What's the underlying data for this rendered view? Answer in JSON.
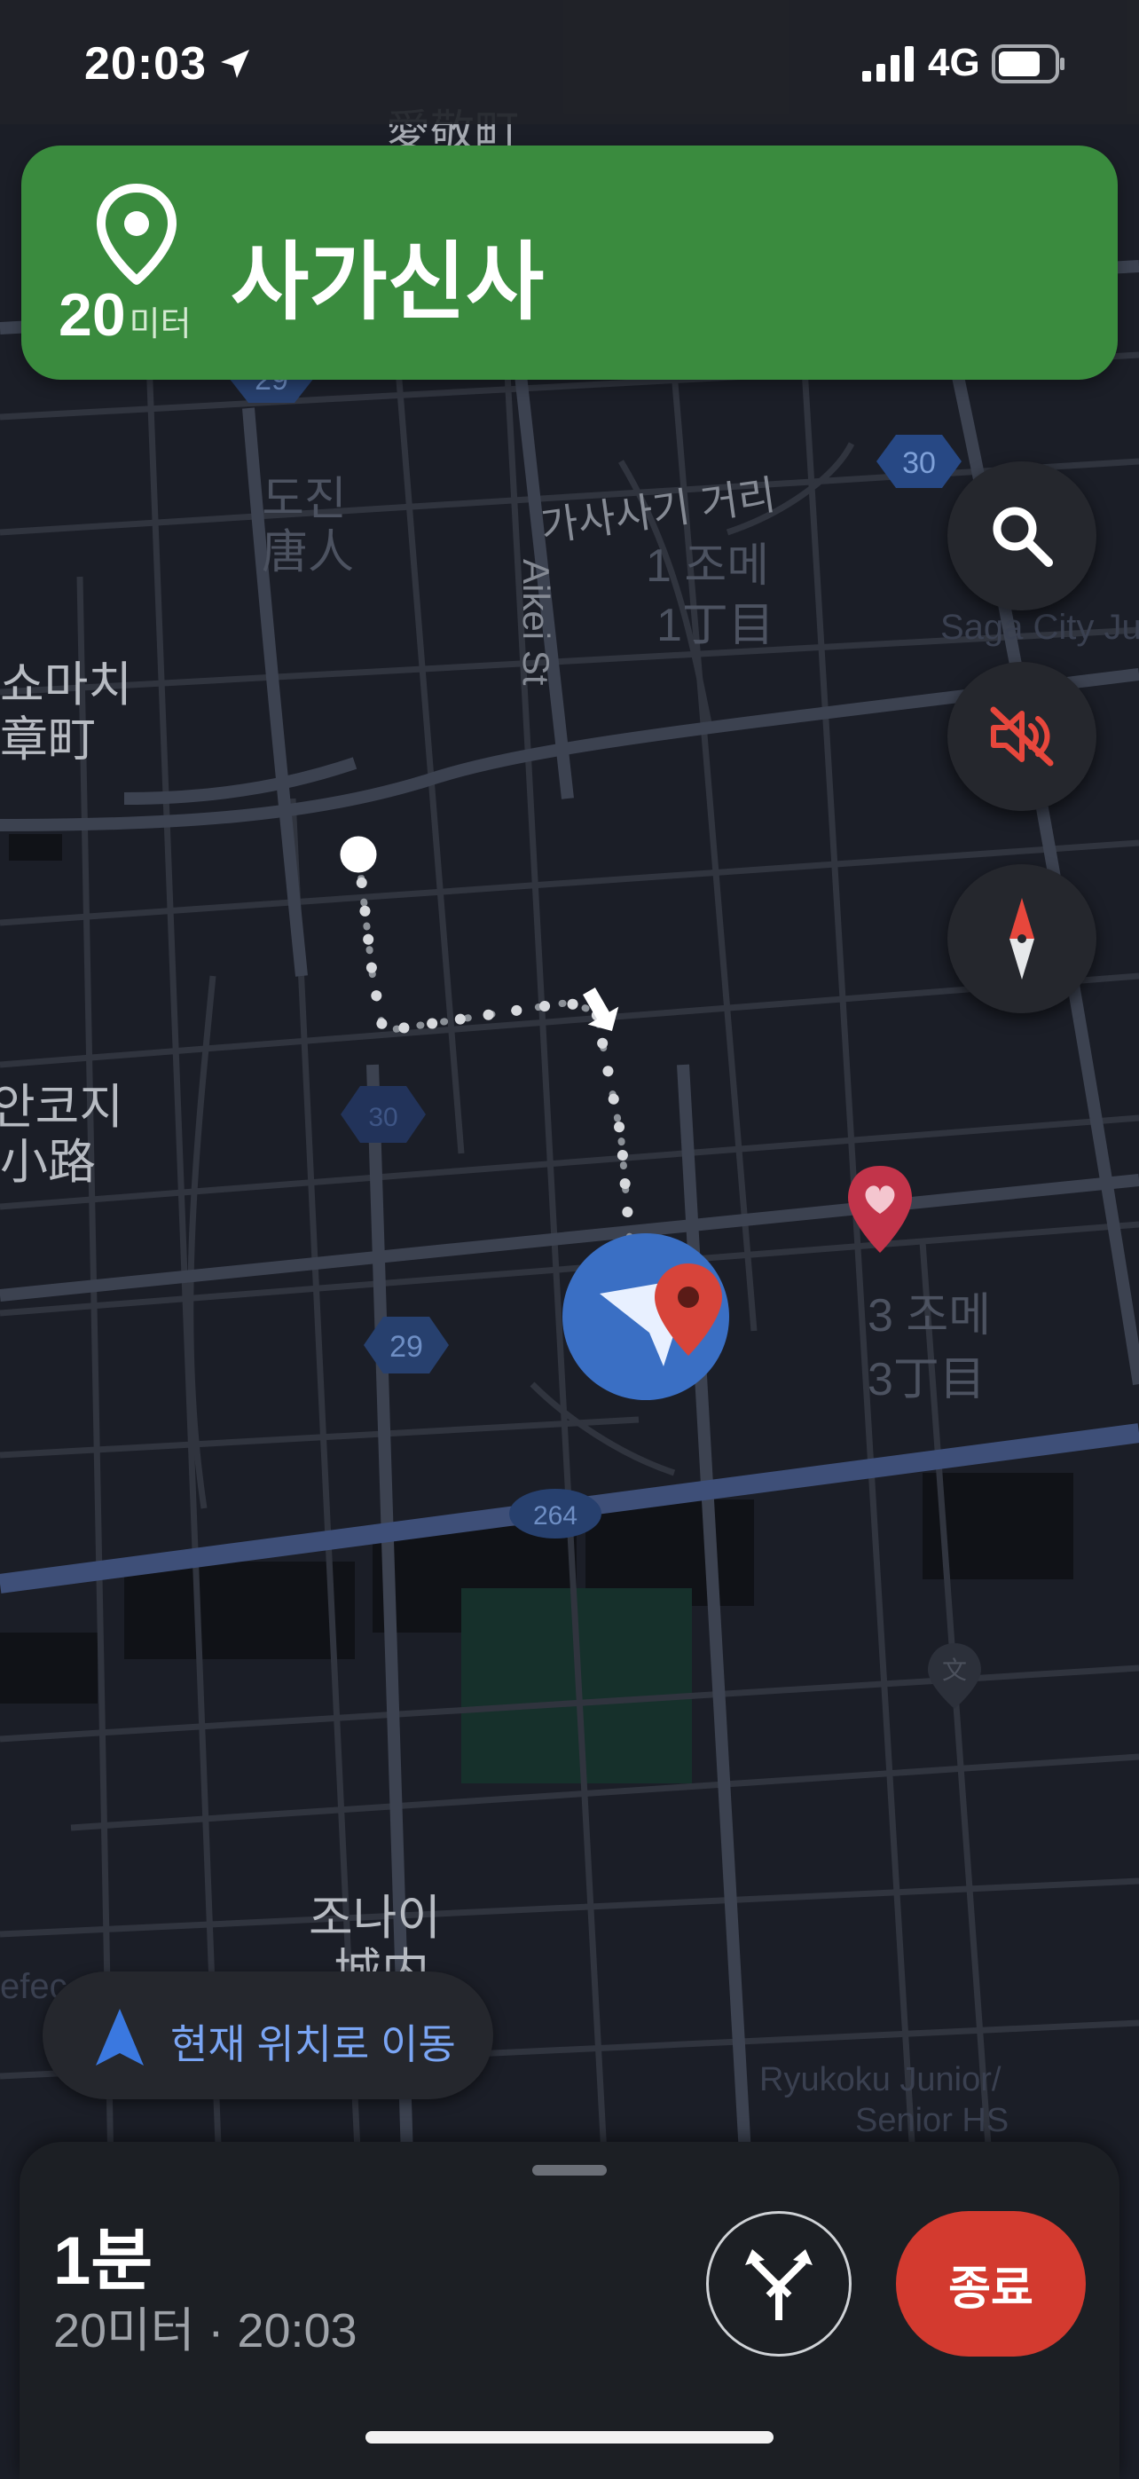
{
  "status_bar": {
    "time": "20:03",
    "network": "4G",
    "icons": [
      "location-arrow-icon",
      "signal-bars-icon",
      "battery-icon"
    ]
  },
  "nav_banner": {
    "distance_value": "20",
    "distance_unit": "미터",
    "street_name": "사가신사",
    "icon": "destination-pin-icon",
    "color": "#3a8b3e"
  },
  "map": {
    "labels": {
      "road_garbled": "愛敬町",
      "tojin": "도진",
      "tojin_kanji": "唐人",
      "kasashiki_street": "가사사기 거리",
      "jome_1": "1 조메",
      "jome_1_kanji": "1丁目",
      "aikei_st": "Aikei St",
      "saga_city_partial": "Saga City Ju",
      "shomachi": "쇼마치",
      "shomachi_kanji": "章町",
      "koji": "안코지",
      "koji_kanji": "小路",
      "jome_3": "3 조메",
      "jome_3_kanji": "3丁目",
      "jonai": "조나이",
      "jonai_kanji": "城内",
      "ryukoku": "Ryukoku Junior/",
      "ryukoku_2": "Senior HS",
      "prefecture_partial": "efec"
    },
    "route_shields": [
      "29",
      "30",
      "29",
      "264",
      "30"
    ],
    "route_color": "#8b9097",
    "location_color": "#3a6fc4",
    "poi_color": "#c2344a"
  },
  "fabs": {
    "search": {
      "icon": "search-icon"
    },
    "mute": {
      "icon": "sound-off-icon",
      "color": "#e7473c"
    },
    "compass": {
      "icon": "compass-icon"
    }
  },
  "recenter": {
    "label": "현재 위치로 이동",
    "icon": "navigation-arrow-icon",
    "color": "#7aa5f4"
  },
  "bottom_sheet": {
    "eta_time": "1분",
    "eta_detail": "20미터 · 20:03",
    "alt_route_icon": "alternate-routes-icon",
    "exit_label": "종료",
    "exit_color": "#d33a2f"
  }
}
